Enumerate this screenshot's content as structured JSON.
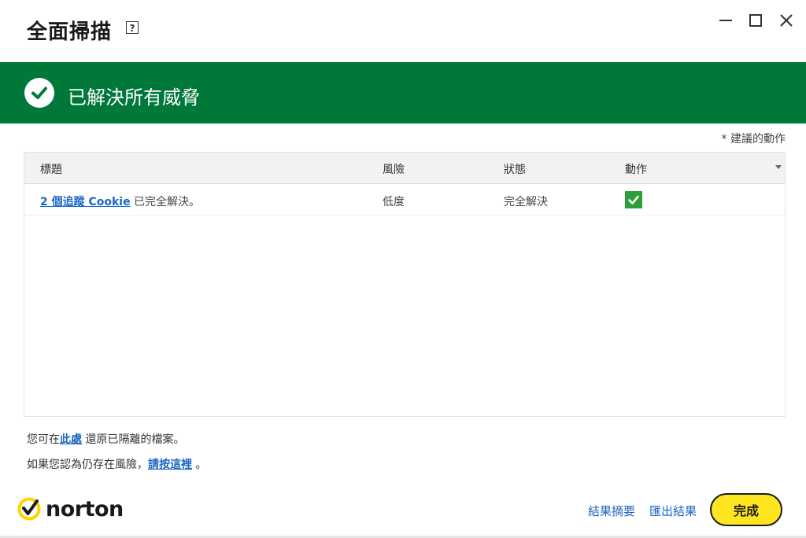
{
  "window": {
    "title": "全面掃描",
    "help_label": "?",
    "controls": [
      "minimize-icon",
      "maximize-icon",
      "close-icon"
    ]
  },
  "banner": {
    "text": "已解決所有威脅",
    "color": "#00783a",
    "icon": "check-circle-icon"
  },
  "recommended_note": "* 建議的動作",
  "table": {
    "headers": {
      "title": "標題",
      "risk": "風險",
      "status": "狀態",
      "action": "動作"
    },
    "rows": [
      {
        "title_link": "2 個追蹤 Cookie",
        "title_suffix": " 已完全解決。",
        "risk": "低度",
        "status": "完全解決",
        "action_icon": "checkbox-checked-icon"
      }
    ]
  },
  "notes": {
    "restore_prefix": "您可在",
    "restore_link": "此處",
    "restore_suffix": "還原已隔離的檔案。",
    "risk_prefix": "如果您認為仍存在風險，",
    "risk_link": "請按這裡",
    "risk_suffix": "。"
  },
  "footer": {
    "brand": "norton",
    "summary_link": "結果摘要",
    "export_link": "匯出結果",
    "done_button": "完成",
    "accent_color": "#ffe51f"
  }
}
